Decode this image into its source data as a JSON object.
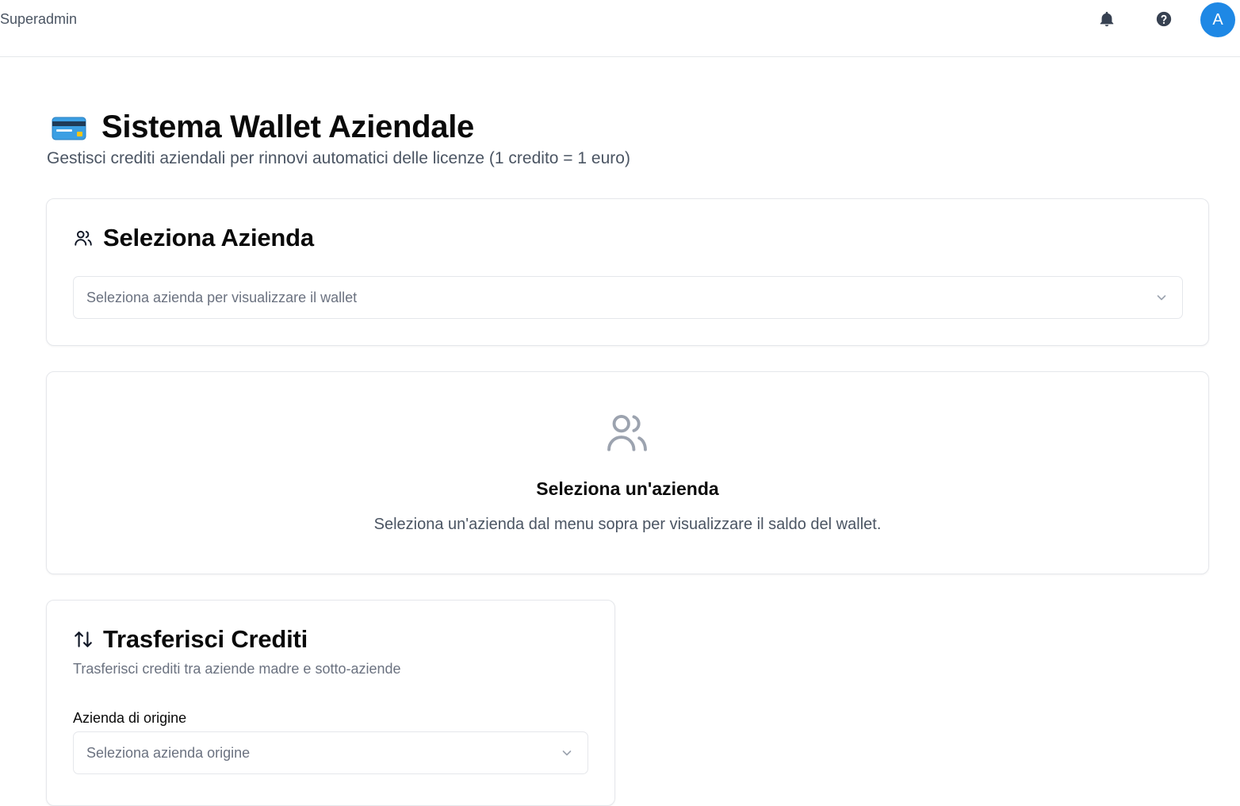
{
  "header": {
    "brand": "Superadmin",
    "avatar_letter": "A",
    "icons": [
      "bell-icon",
      "help-circle-icon"
    ]
  },
  "page": {
    "title": "Sistema Wallet Aziendale",
    "title_emoji": "credit-card-icon",
    "subtitle": "Gestisci crediti aziendali per rinnovi automatici delle licenze (1 credito = 1 euro)"
  },
  "select_company": {
    "title": "Seleziona Azienda",
    "icon": "users-icon",
    "placeholder": "Seleziona azienda per visualizzare il wallet"
  },
  "empty_state": {
    "icon": "users-icon",
    "title": "Seleziona un'azienda",
    "text": "Seleziona un'azienda dal menu sopra per visualizzare il saldo del wallet."
  },
  "transfer": {
    "title": "Trasferisci Crediti",
    "icon": "arrow-up-down-icon",
    "description": "Trasferisci crediti tra aziende madre e sotto-aziende",
    "source_label": "Azienda di origine",
    "source_placeholder": "Seleziona azienda origine"
  },
  "colors": {
    "accent": "#1e88e5",
    "muted_text": "#6b7280",
    "border": "#e5e7eb"
  }
}
